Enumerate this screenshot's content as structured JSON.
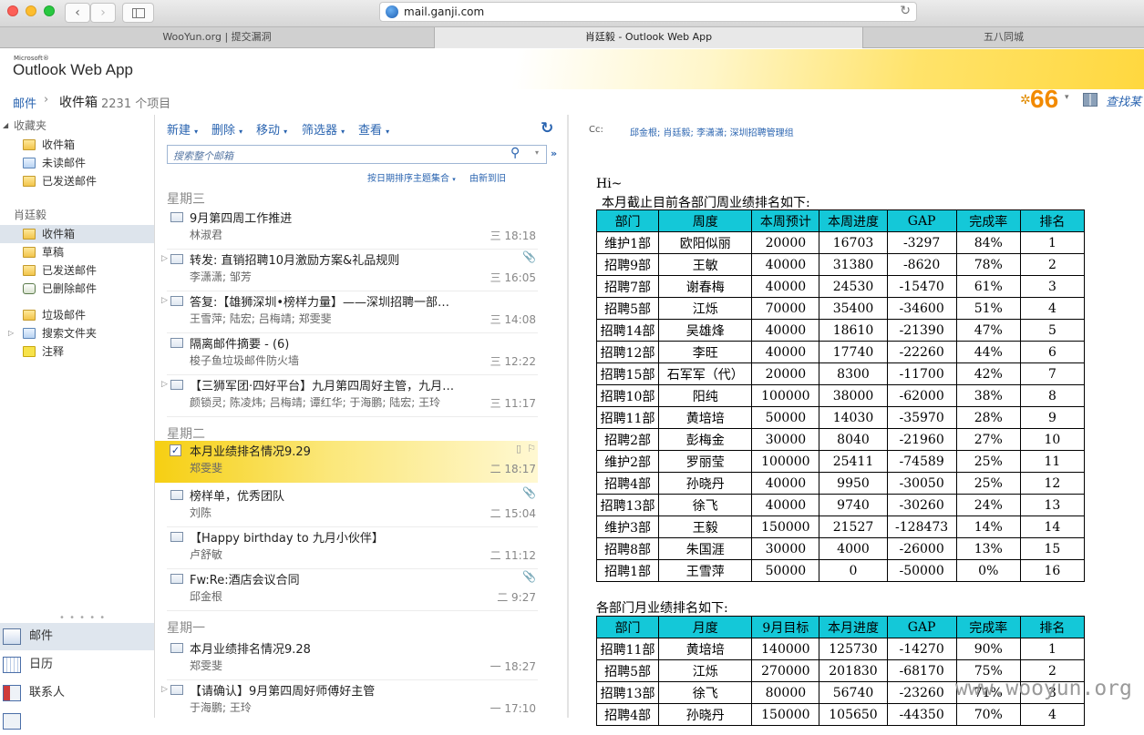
{
  "browser": {
    "url": "mail.ganji.com",
    "tabs": [
      {
        "label": "WooYun.org | 提交漏洞"
      },
      {
        "label": "肖廷毅 - Outlook Web App"
      },
      {
        "label": "五八同城"
      }
    ]
  },
  "owa": {
    "logo_small": "Microsoft®",
    "logo": "Outlook Web App",
    "badge_count": "66",
    "find_label": "查找某",
    "breadcrumb": {
      "root": "邮件",
      "folder": "收件箱",
      "count": "2231 个项目"
    }
  },
  "leftnav": {
    "favorites_header": "收藏夹",
    "favorites": [
      {
        "label": "收件箱"
      },
      {
        "label": "未读邮件"
      },
      {
        "label": "已发送邮件"
      }
    ],
    "account_header": "肖廷毅",
    "folders": [
      {
        "label": "收件箱"
      },
      {
        "label": "草稿"
      },
      {
        "label": "已发送邮件"
      },
      {
        "label": "已删除邮件"
      },
      {
        "label": "垃圾邮件"
      },
      {
        "label": "搜索文件夹"
      },
      {
        "label": "注释"
      }
    ],
    "modules": [
      {
        "label": "邮件"
      },
      {
        "label": "日历"
      },
      {
        "label": "联系人"
      }
    ]
  },
  "toolbar": {
    "new": "新建",
    "delete": "删除",
    "move": "移动",
    "filter": "筛选器",
    "view": "查看",
    "search_placeholder": "搜索整个邮箱",
    "sort_label": "按日期排序主题集合",
    "order_label": "由新到旧"
  },
  "message_groups": [
    {
      "day": "星期三",
      "messages": [
        {
          "subject": "9月第四周工作推进",
          "from": "林淑君",
          "time": "三 18:18"
        },
        {
          "subject": "转发: 直销招聘10月激励方案&礼品规则",
          "from": "李潇潇; 邹芳",
          "time": "三 16:05"
        },
        {
          "subject": "答复:【雄狮深圳•榜样力量】——深圳招聘一部…",
          "from": "王雪萍; 陆宏; 吕梅靖; 郑雯斐",
          "time": "三 14:08"
        },
        {
          "subject": "隔离邮件摘要 - (6)",
          "from": "梭子鱼垃圾邮件防火墙",
          "time": "三 12:22"
        },
        {
          "subject": "【三狮军团·四好平台】九月第四周好主管，九月…",
          "from": "颜锁灵; 陈凌炜; 吕梅靖; 谭红华; 于海鹏; 陆宏; 王玲",
          "time": "三 11:17"
        }
      ]
    },
    {
      "day": "星期二",
      "messages": [
        {
          "subject": "本月业绩排名情况9.29",
          "from": "郑雯斐",
          "time": "二 18:17"
        },
        {
          "subject": "榜样单，优秀团队",
          "from": "刘陈",
          "time": "二 15:04"
        },
        {
          "subject": "【Happy birthday to 九月小伙伴】",
          "from": "卢舒敏",
          "time": "二 11:12"
        },
        {
          "subject": "Fw:Re:酒店会议合同",
          "from": "邱金根",
          "time": "二 9:27"
        }
      ]
    },
    {
      "day": "星期一",
      "messages": [
        {
          "subject": "本月业绩排名情况9.28",
          "from": "郑雯斐",
          "time": "一 18:27"
        },
        {
          "subject": "【请确认】9月第四周好师傅好主管",
          "from": "于海鹏; 王玲",
          "time": "一 17:10"
        }
      ]
    }
  ],
  "reading": {
    "cc_label": "Cc:",
    "cc_value": "邱金根; 肖廷毅; 李潇潇; 深圳招聘管理组",
    "greeting": "Hi~",
    "intro1": "本月截止目前各部门周业绩排名如下:",
    "table1": {
      "headers": [
        "部门",
        "周度",
        "本周预计",
        "本周进度",
        "GAP",
        "完成率",
        "排名"
      ],
      "rows": [
        [
          "维护1部",
          "欧阳似丽",
          "20000",
          "16703",
          "-3297",
          "84%",
          "1"
        ],
        [
          "招聘9部",
          "王敏",
          "40000",
          "31380",
          "-8620",
          "78%",
          "2"
        ],
        [
          "招聘7部",
          "谢春梅",
          "40000",
          "24530",
          "-15470",
          "61%",
          "3"
        ],
        [
          "招聘5部",
          "江烁",
          "70000",
          "35400",
          "-34600",
          "51%",
          "4"
        ],
        [
          "招聘14部",
          "吴雄烽",
          "40000",
          "18610",
          "-21390",
          "47%",
          "5"
        ],
        [
          "招聘12部",
          "李旺",
          "40000",
          "17740",
          "-22260",
          "44%",
          "6"
        ],
        [
          "招聘15部",
          "石军军（代）",
          "20000",
          "8300",
          "-11700",
          "42%",
          "7"
        ],
        [
          "招聘10部",
          "阳纯",
          "100000",
          "38000",
          "-62000",
          "38%",
          "8"
        ],
        [
          "招聘11部",
          "黄培培",
          "50000",
          "14030",
          "-35970",
          "28%",
          "9"
        ],
        [
          "招聘2部",
          "彭梅金",
          "30000",
          "8040",
          "-21960",
          "27%",
          "10"
        ],
        [
          "维护2部",
          "罗丽莹",
          "100000",
          "25411",
          "-74589",
          "25%",
          "11"
        ],
        [
          "招聘4部",
          "孙晓丹",
          "40000",
          "9950",
          "-30050",
          "25%",
          "12"
        ],
        [
          "招聘13部",
          "徐飞",
          "40000",
          "9740",
          "-30260",
          "24%",
          "13"
        ],
        [
          "维护3部",
          "王毅",
          "150000",
          "21527",
          "-128473",
          "14%",
          "14"
        ],
        [
          "招聘8部",
          "朱国涯",
          "30000",
          "4000",
          "-26000",
          "13%",
          "15"
        ],
        [
          "招聘1部",
          "王雪萍",
          "50000",
          "0",
          "-50000",
          "0%",
          "16"
        ]
      ]
    },
    "intro2": "各部门月业绩排名如下:",
    "table2": {
      "headers": [
        "部门",
        "月度",
        "9月目标",
        "本月进度",
        "GAP",
        "完成率",
        "排名"
      ],
      "rows": [
        [
          "招聘11部",
          "黄培培",
          "140000",
          "125730",
          "-14270",
          "90%",
          "1"
        ],
        [
          "招聘5部",
          "江烁",
          "270000",
          "201830",
          "-68170",
          "75%",
          "2"
        ],
        [
          "招聘13部",
          "徐飞",
          "80000",
          "56740",
          "-23260",
          "71%",
          "3"
        ],
        [
          "招聘4部",
          "孙晓丹",
          "150000",
          "105650",
          "-44350",
          "70%",
          "4"
        ]
      ]
    }
  },
  "watermark": "www.wooyun.org",
  "colors": {
    "table_header": "#14c8d8",
    "selected_message": "#f6cf12",
    "link": "#2a64b0",
    "badge": "#f28a00"
  }
}
